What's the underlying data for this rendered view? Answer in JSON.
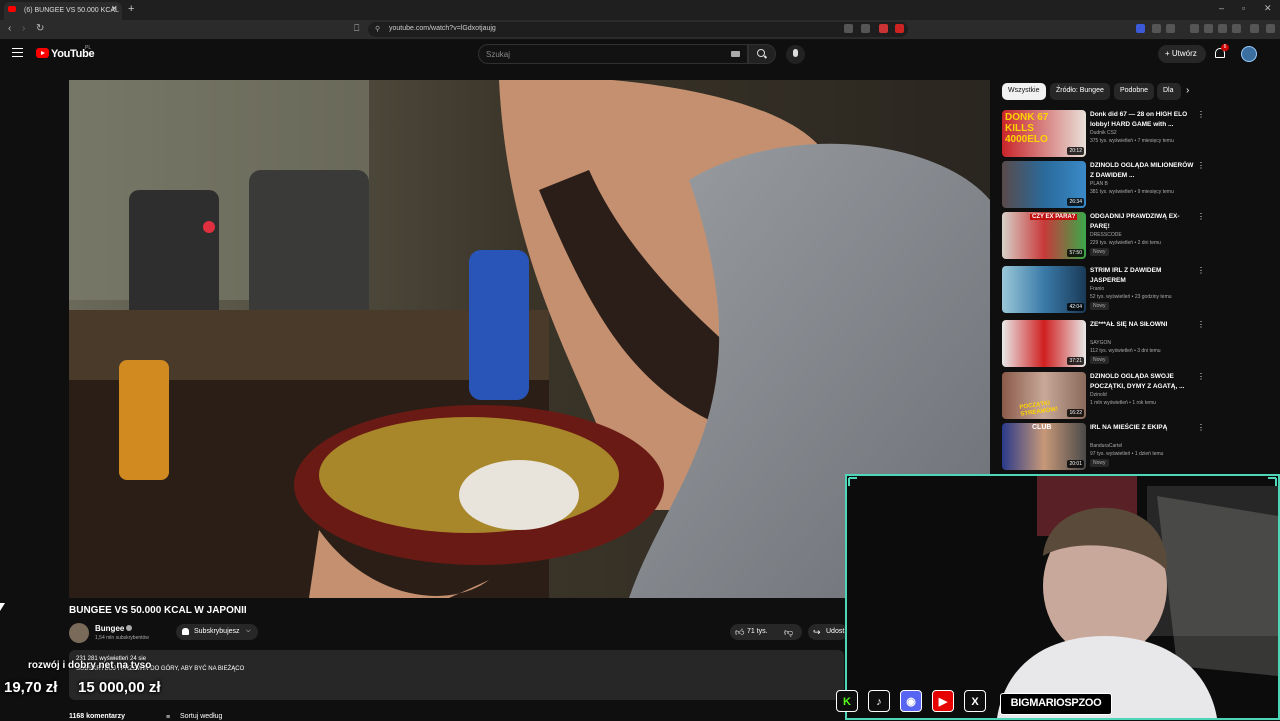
{
  "browser": {
    "tab_title": "(6) BUNGEE VS 50.000 KCAL",
    "url": "youtube.com/watch?v=lGdxotjaujg"
  },
  "header": {
    "logo": "YouTube",
    "region": "PL",
    "search_placeholder": "Szukaj",
    "create_label": "Utwórz",
    "notification_count": "6"
  },
  "video": {
    "title": "BUNGEE VS 50.000 KCAL W JAPONII",
    "channel": "Bungee",
    "subscribers": "1,54 mln subskrybentów",
    "subscribe_label": "Subskrybujesz",
    "likes": "71 tys.",
    "share_label": "Udost",
    "description_meta": "231 281 wyświetleń  24 sie",
    "description_text": "SUBSKRYBUJ I PRZEWIŃ DO GÓRY, ABY BYĆ NA BIEŻĄCO",
    "comments_count": "1168 komentarzy",
    "sort_label": "Sortuj według"
  },
  "chips": [
    "Wszystkie",
    "Źródło: Bungee",
    "Podobne",
    "Dla"
  ],
  "recommendations": [
    {
      "title": "Donk did 67 — 28 on HIGH ELO lobby! HARD GAME with ...",
      "channel": "Dudnik CS2",
      "meta": "375 tys. wyświetleń • 7 miesięcy temu",
      "duration": "20:12",
      "badge": "",
      "thumb_text": "DONK 67 KILLS 4000ELO"
    },
    {
      "title": "DZINOLD OGLĄDA MILIONERÓW Z DAWIDEM ...",
      "channel": "PLAN B",
      "meta": "381 tys. wyświetleń • 9 miesięcy temu",
      "duration": "26:34",
      "badge": "",
      "thumb_text": ""
    },
    {
      "title": "ODGADNIJ PRAWDZIWĄ EX-PARĘ!",
      "channel": "DRESSCODE",
      "meta": "229 tys. wyświetleń • 2 dni temu",
      "duration": "57:50",
      "badge": "Nowy",
      "thumb_text": "CZY EX PARA?"
    },
    {
      "title": "STRIM IRL Z DAWIDEM JASPEREM",
      "channel": "Franio",
      "meta": "52 tys. wyświetleń • 23 godziny temu",
      "duration": "42:04",
      "badge": "Nowy",
      "thumb_text": ""
    },
    {
      "title": "ZE***AŁ SIĘ NA SIŁOWNI",
      "channel": "SAYGON",
      "meta": "112 tys. wyświetleń • 3 dni temu",
      "duration": "37:21",
      "badge": "Nowy",
      "thumb_text": ""
    },
    {
      "title": "DZINOLD OGLĄDA SWOJE POCZĄTKI, DYMY Z AGATĄ, ...",
      "channel": "Dzinold",
      "meta": "1 mln wyświetleń • 1 rok temu",
      "duration": "16:22",
      "badge": "",
      "thumb_text": "POCZĄTKI STREAMÓW!"
    },
    {
      "title": "IRL NA MIEŚCIE Z EKIPĄ",
      "channel": "BanduraCartel",
      "meta": "97 tys. wyświetleń • 1 dzień temu",
      "duration": "20:01",
      "badge": "Nowy",
      "thumb_text": "CLUB"
    }
  ],
  "overlay": {
    "donation_message": "rozwój i dobry net na tyso",
    "donation_amount": "19,70 zł",
    "donation_goal": "15 000,00 zł",
    "streamer_handle": "BIGMARIOSPZOO",
    "social_icons": [
      "K",
      "♪",
      "◉",
      "▶",
      "X"
    ]
  },
  "colors": {
    "accent_red": "#ff0000",
    "webcam_border": "#4fd6b8",
    "background": "#0f0f0f"
  }
}
